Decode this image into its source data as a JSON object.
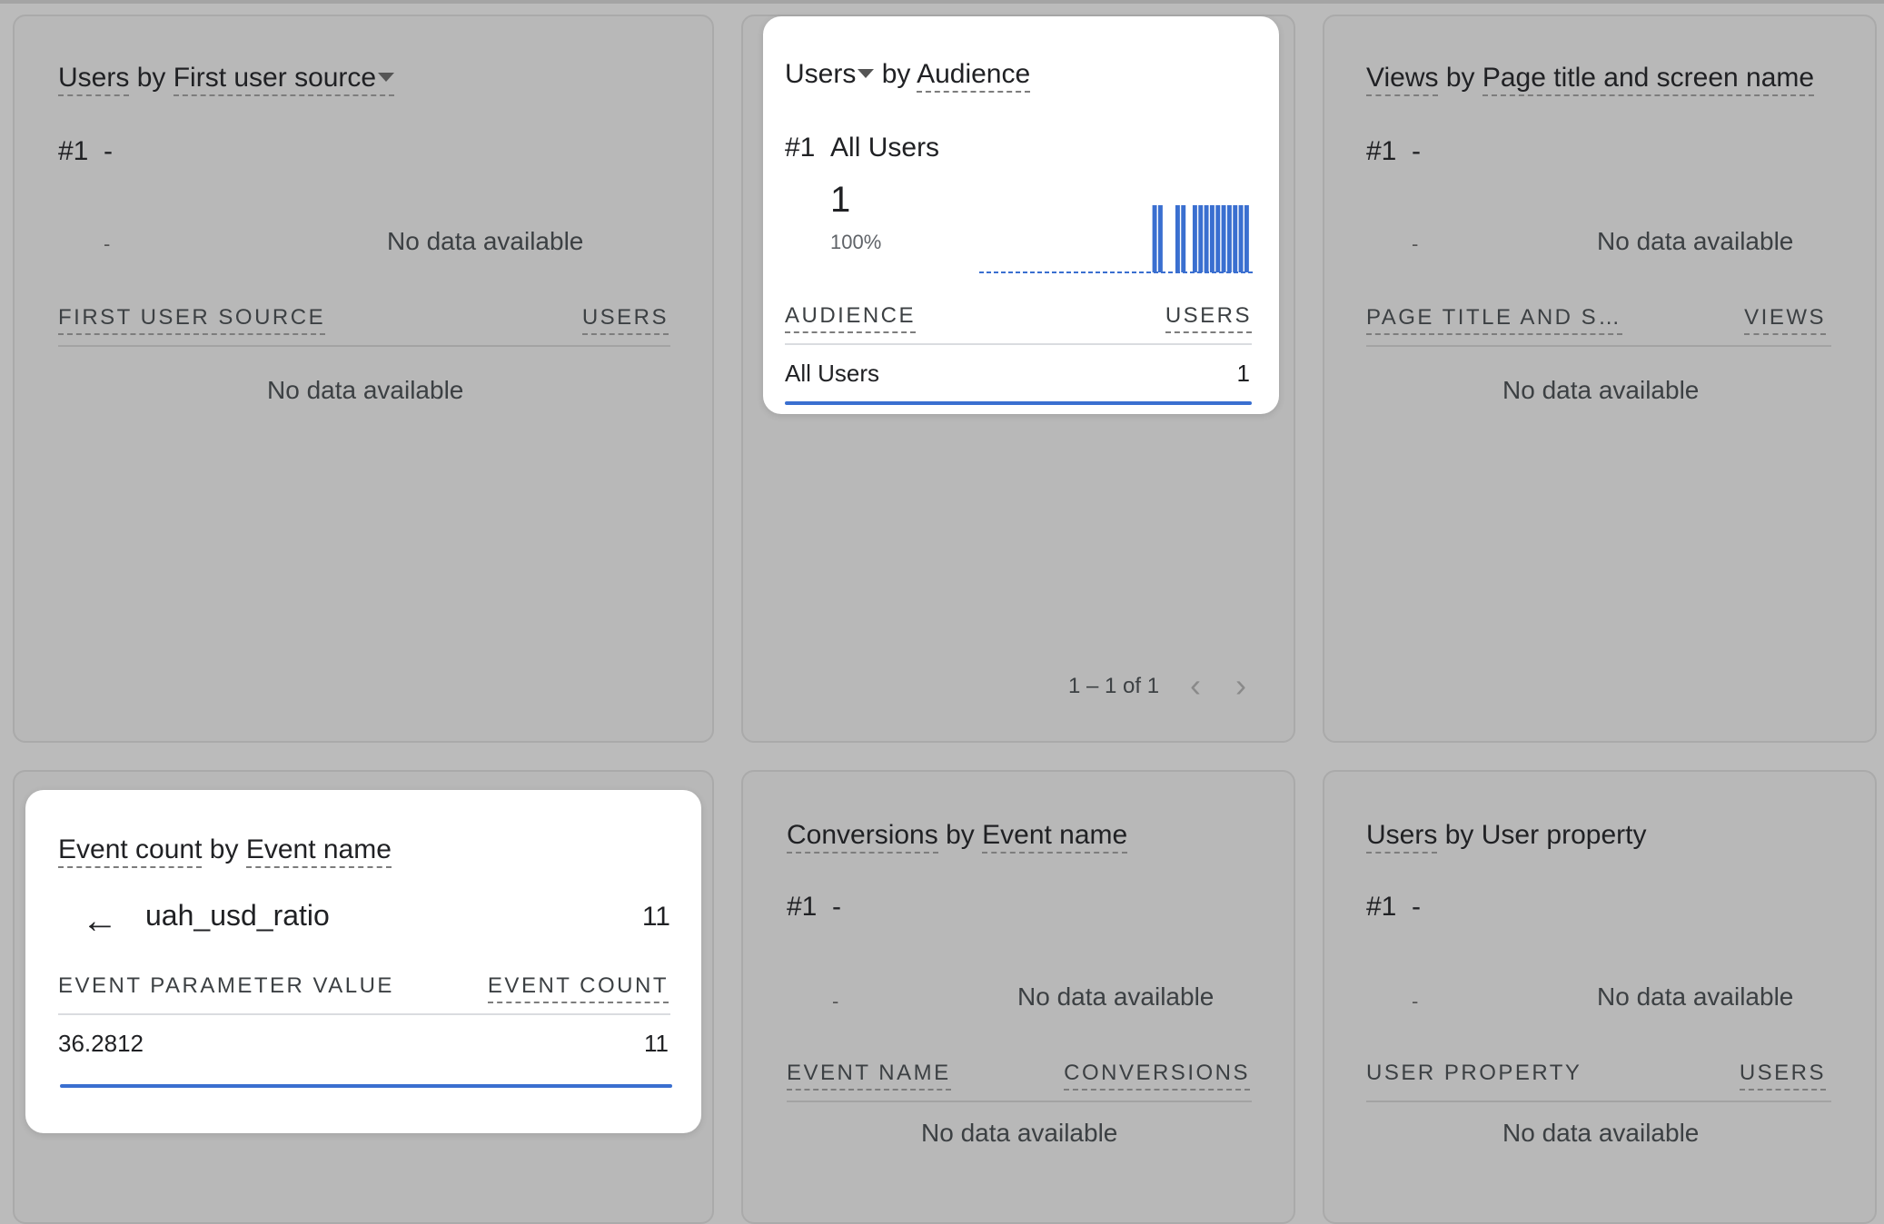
{
  "cards": {
    "first_user_source": {
      "title_metric": "Users",
      "title_by": "by",
      "title_dim": "First user source",
      "rank": "#1",
      "rank_value": "-",
      "mini_dash": "-",
      "chart_nodata": "No data available",
      "col1": "FIRST USER SOURCE",
      "col2": "USERS",
      "table_nodata": "No data available"
    },
    "audience": {
      "title_metric": "Users",
      "title_by": "by",
      "title_dim": "Audience",
      "rank": "#1",
      "rank_value": "All Users",
      "value": "1",
      "percent": "100%",
      "col1": "AUDIENCE",
      "col2": "USERS",
      "row_label": "All Users",
      "row_value": "1",
      "pager": "1 – 1 of 1",
      "accent": "#3a6fd0"
    },
    "page_title": {
      "title_metric": "Views",
      "title_by": "by",
      "title_dim": "Page title and screen name",
      "rank": "#1",
      "rank_value": "-",
      "mini_dash": "-",
      "chart_nodata": "No data available",
      "col1": "PAGE TITLE AND S…",
      "col2": "VIEWS",
      "table_nodata": "No data available"
    },
    "event_count": {
      "title_metric": "Event count",
      "title_by": "by",
      "title_dim": "Event name",
      "back_icon": "arrow-left-icon",
      "event_name": "uah_usd_ratio",
      "event_total": "11",
      "col1": "EVENT PARAMETER VALUE",
      "col2": "EVENT COUNT",
      "row_label": "36.2812",
      "row_value": "11"
    },
    "conversions": {
      "title_metric": "Conversions",
      "title_by": "by",
      "title_dim": "Event name",
      "rank": "#1",
      "rank_value": "-",
      "mini_dash": "-",
      "chart_nodata": "No data available",
      "col1": "EVENT NAME",
      "col2": "CONVERSIONS",
      "table_nodata": "No data available"
    },
    "user_property": {
      "title_metric": "Users",
      "title_by": "by",
      "title_dim": "User property",
      "rank": "#1",
      "rank_value": "-",
      "mini_dash": "-",
      "chart_nodata": "No data available",
      "col1": "USER PROPERTY",
      "col2": "USERS",
      "table_nodata": "No data available"
    }
  },
  "chart_data": {
    "type": "bar",
    "values": [
      0,
      0,
      0,
      0,
      0,
      0,
      0,
      0,
      0,
      0,
      0,
      0,
      0,
      0,
      0,
      0,
      0,
      0,
      0,
      0,
      0,
      0,
      0,
      0,
      0,
      0,
      0,
      0,
      0,
      0,
      1,
      1,
      0,
      0,
      1,
      1,
      0,
      1,
      1,
      1,
      1,
      1,
      1,
      1,
      1,
      1,
      1,
      0
    ],
    "ylim": [
      0,
      1
    ]
  }
}
